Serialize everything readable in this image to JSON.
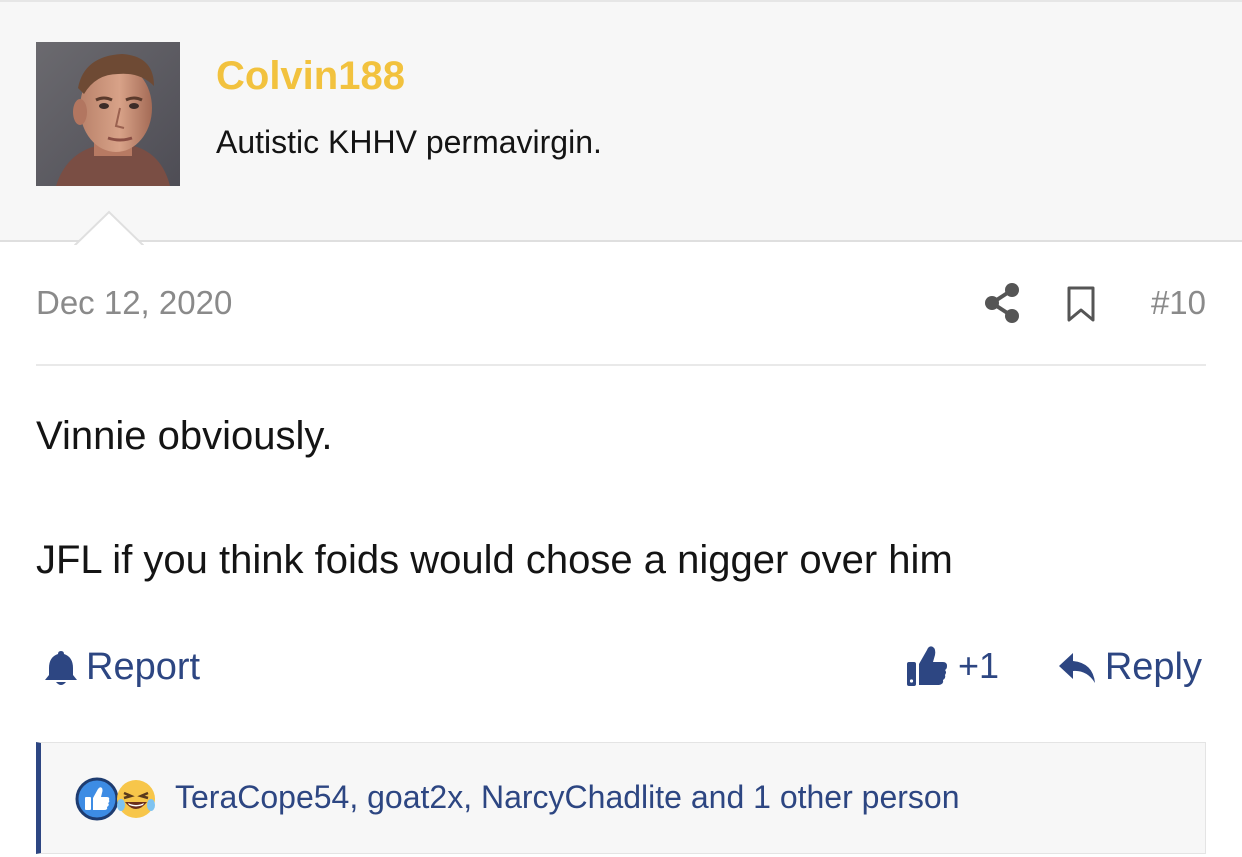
{
  "user": {
    "username": "Colvin188",
    "title": "Autistic KHHV permavirgin.",
    "avatar": "avatar-photo"
  },
  "post": {
    "date": "Dec 12, 2020",
    "number": "#10",
    "body_lines": [
      "Vinnie obviously.",
      "JFL if you think foids would chose a nigger over him"
    ]
  },
  "actions": {
    "report_label": "Report",
    "like_count": "+1",
    "reply_label": "Reply"
  },
  "reactions": {
    "icons": [
      "like-icon",
      "laughing-icon"
    ],
    "users_text": "TeraCope54, goat2x, NarcyChadlite and 1 other person"
  },
  "icons": {
    "share": "share-icon",
    "bookmark": "bookmark-icon",
    "report": "bell-icon",
    "like": "thumbs-up-icon",
    "reply": "reply-arrow-icon"
  },
  "colors": {
    "username": "#f2c23e",
    "link": "#2d4682",
    "muted": "#8a8a8a",
    "header_bg": "#f7f7f7"
  }
}
